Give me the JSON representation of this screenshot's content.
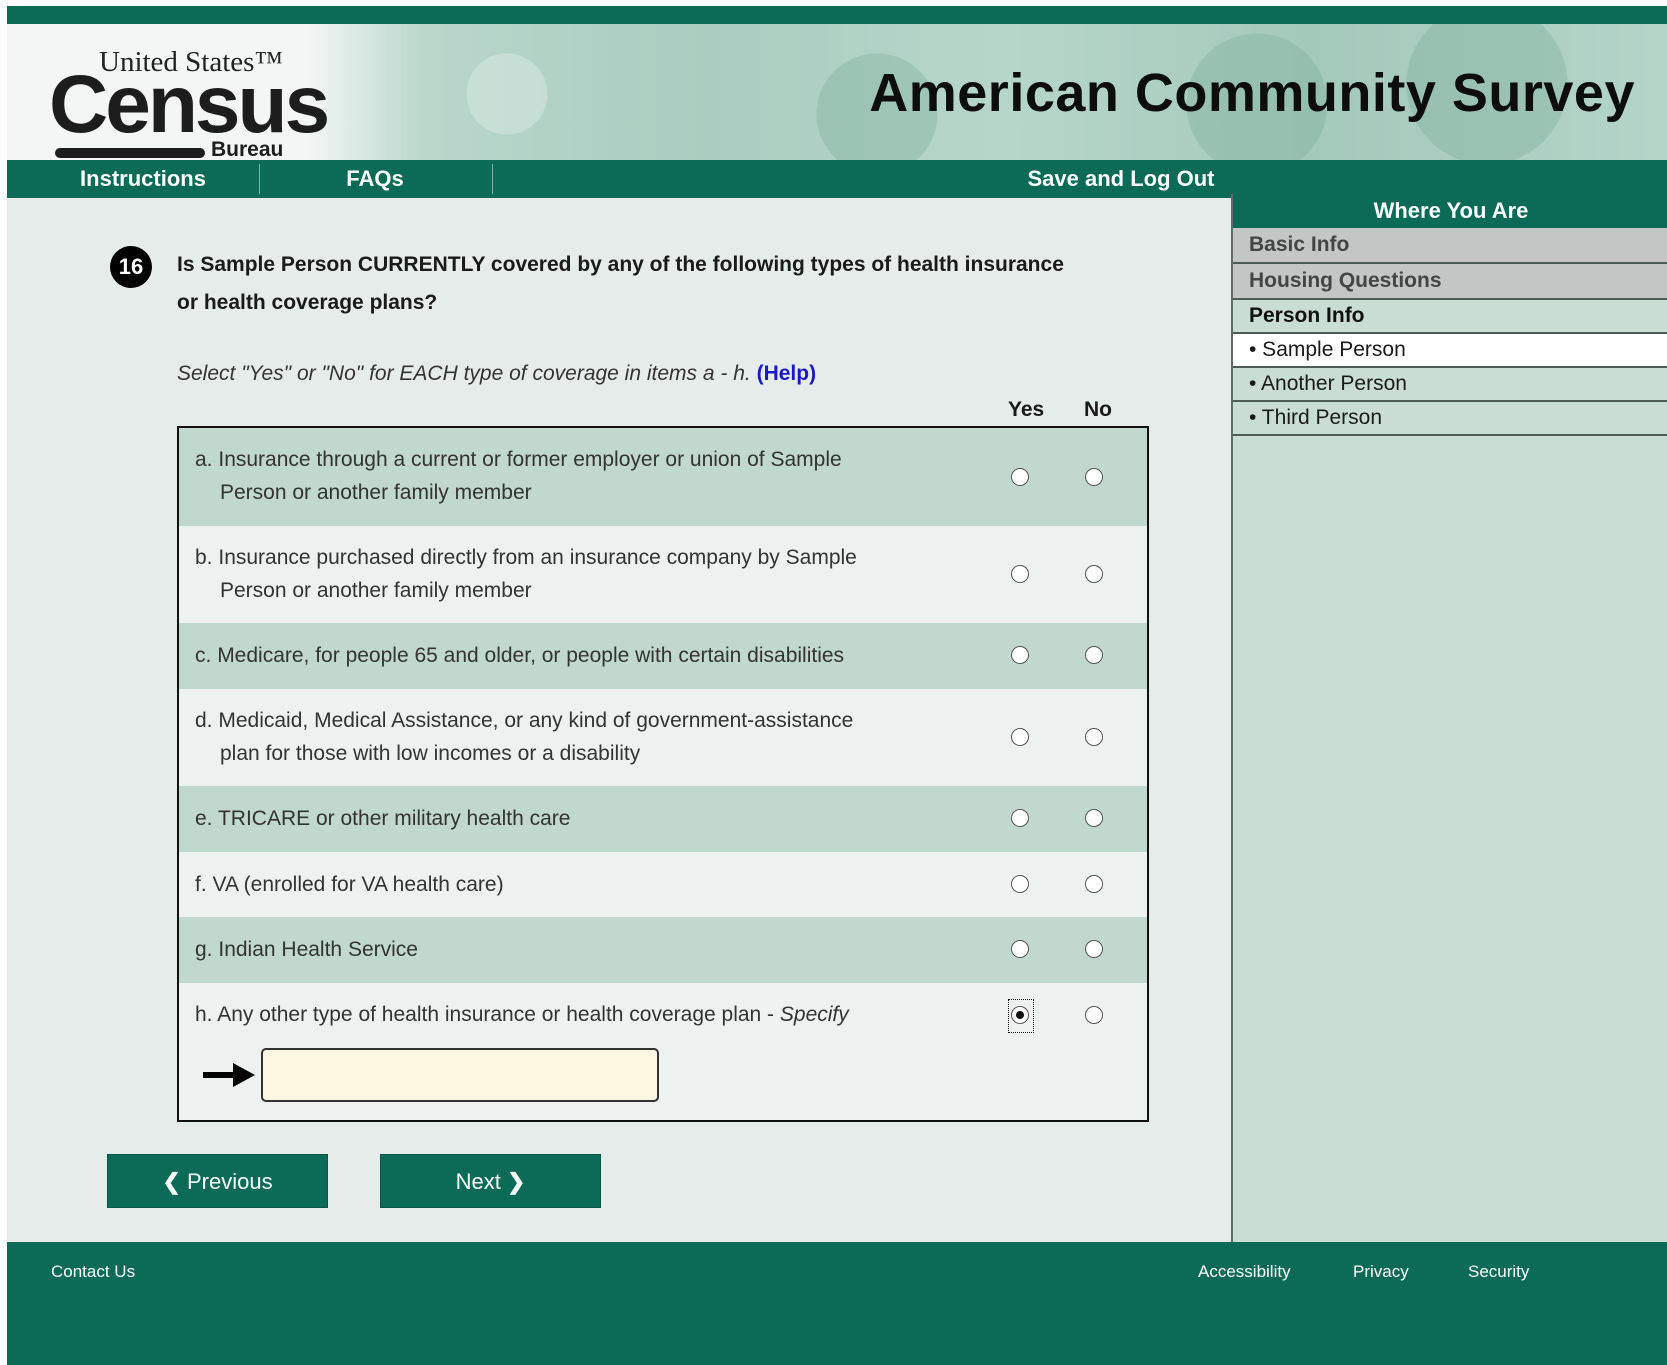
{
  "header": {
    "logo": {
      "line1": "United States™",
      "line2": "Census",
      "line3": "Bureau"
    },
    "title": "American Community Survey"
  },
  "nav": {
    "instructions": "Instructions",
    "faqs": "FAQs",
    "save_logout": "Save and Log Out"
  },
  "question": {
    "number": "16",
    "text": "Is Sample Person CURRENTLY covered by any of the following types of health insurance or health coverage plans?",
    "instruction": "Select \"Yes\" or \"No\" for EACH type of coverage in items a - h.",
    "help_link": "(Help)",
    "col_yes": "Yes",
    "col_no": "No",
    "items": [
      {
        "letter": "a.",
        "text": "Insurance through a current or former employer or union of Sample",
        "text2": "Person or another family member",
        "answer": ""
      },
      {
        "letter": "b.",
        "text": "Insurance purchased directly from an insurance company by Sample",
        "text2": "Person or another family member",
        "answer": ""
      },
      {
        "letter": "c.",
        "text": "Medicare, for people 65 and older, or people with certain disabilities",
        "answer": ""
      },
      {
        "letter": "d.",
        "text": "Medicaid, Medical Assistance, or any kind of government-assistance",
        "text2": "plan for those with low incomes or a disability",
        "answer": ""
      },
      {
        "letter": "e.",
        "text": "TRICARE or other military health care",
        "answer": ""
      },
      {
        "letter": "f.",
        "text": "VA (enrolled for VA health care)",
        "answer": ""
      },
      {
        "letter": "g.",
        "text": "Indian Health Service",
        "answer": ""
      },
      {
        "letter": "h.",
        "text": "Any other type of health insurance or health coverage plan - ",
        "specify": "Specify",
        "answer": "Yes"
      }
    ],
    "specify_value": ""
  },
  "buttons": {
    "previous": "Previous",
    "next": "Next"
  },
  "sidebar": {
    "title": "Where You Are",
    "items": [
      {
        "label": "Basic Info"
      },
      {
        "label": "Housing Questions"
      },
      {
        "label": "Person Info"
      },
      {
        "label": "• Sample Person"
      },
      {
        "label": "• Another Person"
      },
      {
        "label": "• Third Person"
      }
    ]
  },
  "footer": {
    "contact": "Contact Us",
    "accessibility": "Accessibility",
    "privacy": "Privacy",
    "security": "Security"
  },
  "colors": {
    "brand_green": "#0b6b57",
    "row_shade": "#c1d8ce",
    "help_link": "#1a18c8",
    "input_bg": "#fdf6e1"
  }
}
